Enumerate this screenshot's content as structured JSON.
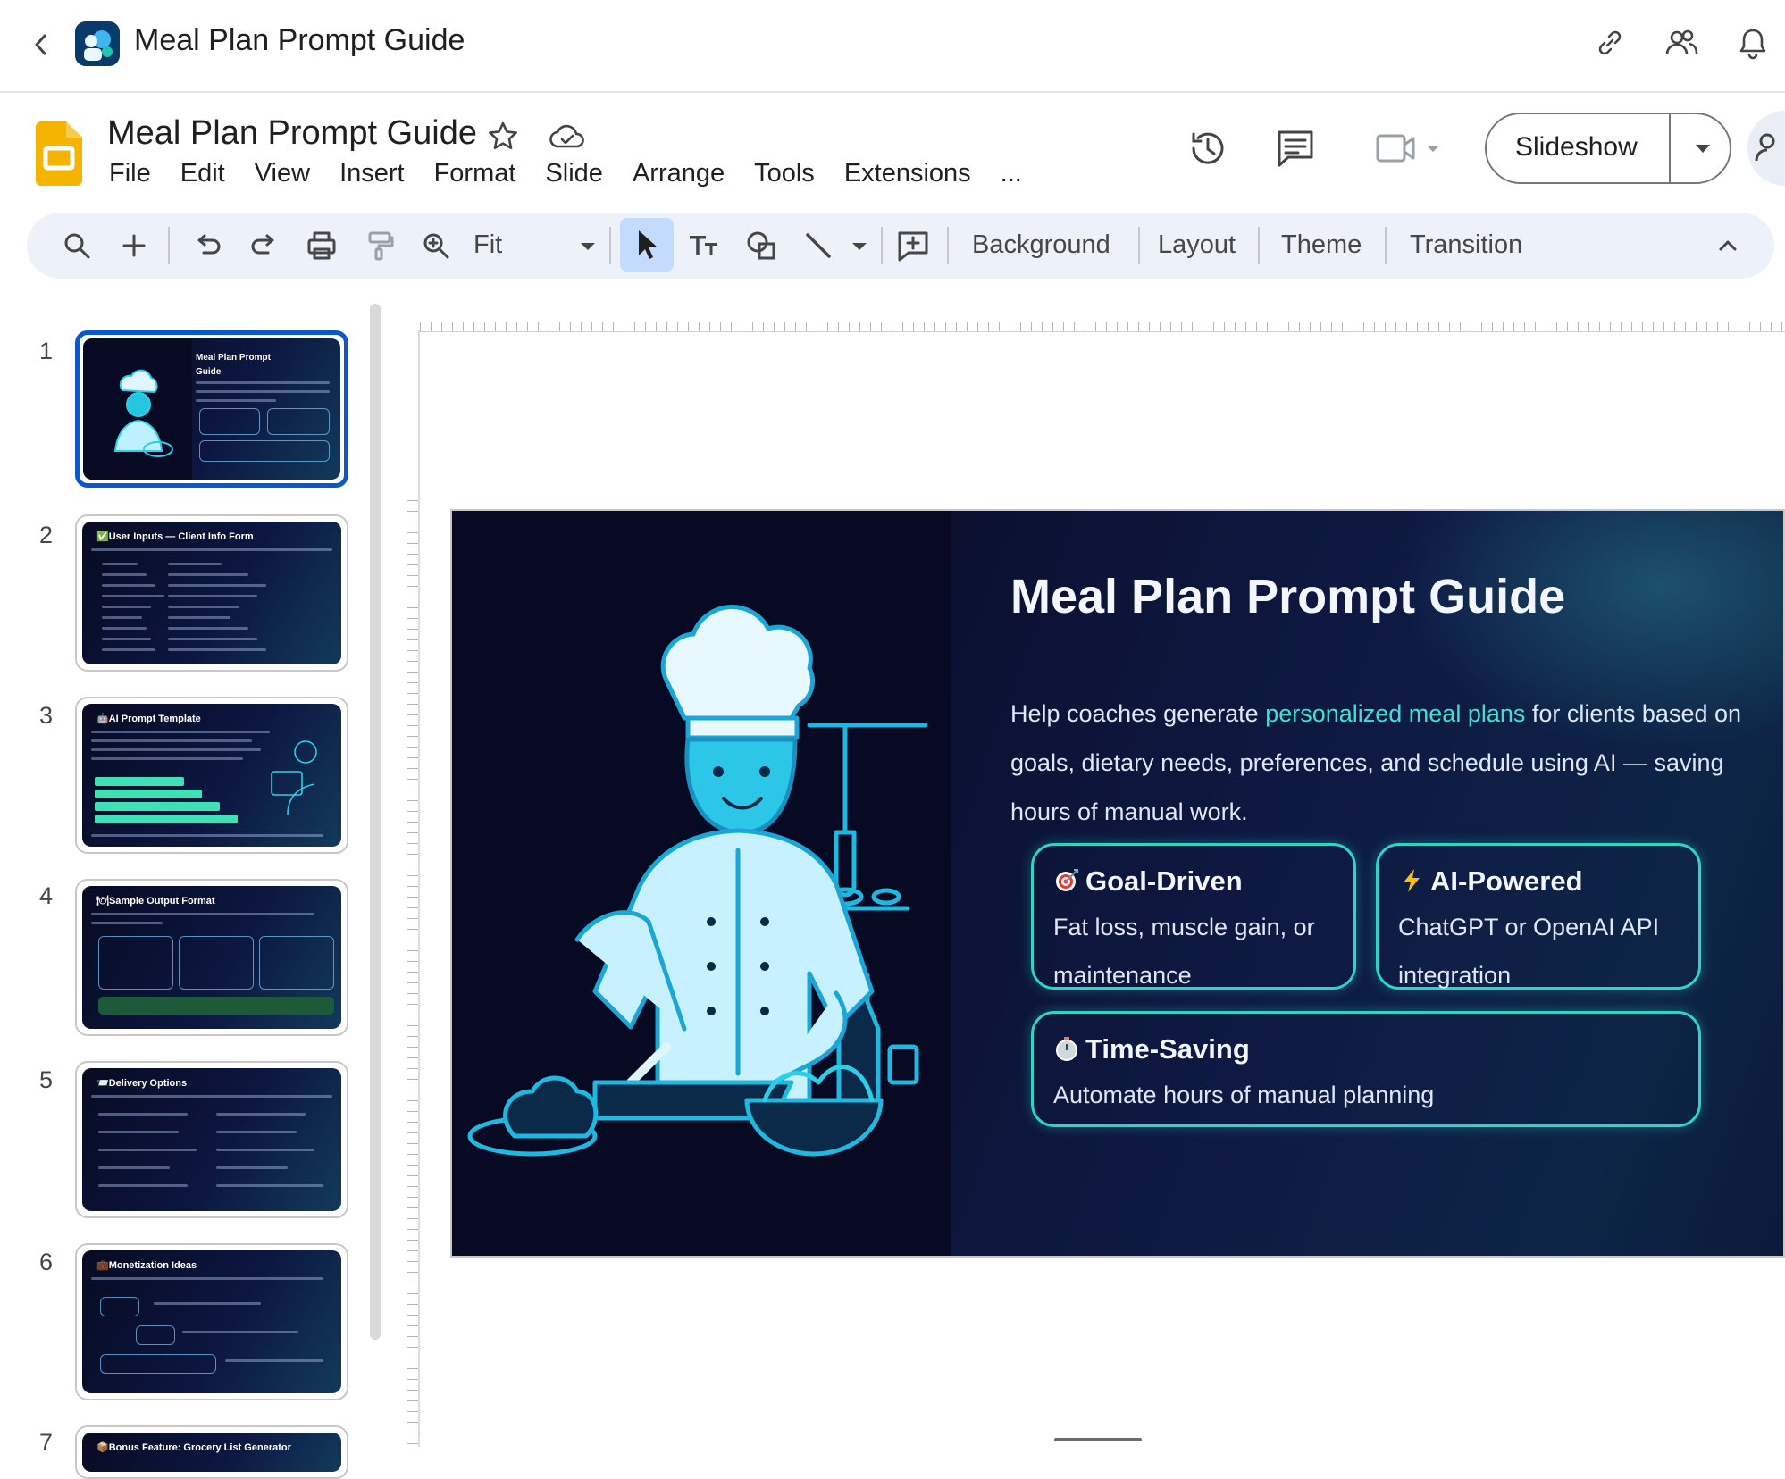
{
  "app": {
    "title": "Meal Plan Prompt Guide"
  },
  "document": {
    "title": "Meal Plan Prompt Guide",
    "menu": [
      "File",
      "Edit",
      "View",
      "Insert",
      "Format",
      "Slide",
      "Arrange",
      "Tools",
      "Extensions",
      "..."
    ],
    "slideshow_label": "Slideshow"
  },
  "toolbar": {
    "zoom_label": "Fit",
    "background": "Background",
    "layout": "Layout",
    "theme": "Theme",
    "transition": "Transition"
  },
  "filmstrip": {
    "selected_index": 1,
    "slides": [
      {
        "number": "1",
        "title": "Meal Plan Prompt Guide"
      },
      {
        "number": "2",
        "title": "✅User Inputs — Client Info Form"
      },
      {
        "number": "3",
        "title": "🤖AI Prompt Template"
      },
      {
        "number": "4",
        "title": "🍽Sample Output Format"
      },
      {
        "number": "5",
        "title": "📨Delivery Options"
      },
      {
        "number": "6",
        "title": "💼Monetization Ideas"
      },
      {
        "number": "7",
        "title": "📦Bonus Feature: Grocery List Generator"
      }
    ]
  },
  "slide": {
    "title": "Meal Plan Prompt Guide",
    "desc_before": "Help coaches generate ",
    "desc_highlight": "personalized meal plans",
    "desc_after": " for clients based on goals, dietary needs, preferences, and schedule using AI — saving hours of manual work.",
    "cards": [
      {
        "title": "Goal-Driven",
        "body": "Fat loss, muscle gain, or maintenance",
        "icon": "target-icon"
      },
      {
        "title": "AI-Powered",
        "body": "ChatGPT or OpenAI API integration",
        "icon": "lightning-icon"
      },
      {
        "title": "Time-Saving",
        "body": "Automate hours of manual planning",
        "icon": "stopwatch-icon"
      }
    ]
  },
  "colors": {
    "accent_teal": "#29d6c9",
    "selection_blue": "#0b57d0",
    "slide_bg": "#05071c"
  }
}
